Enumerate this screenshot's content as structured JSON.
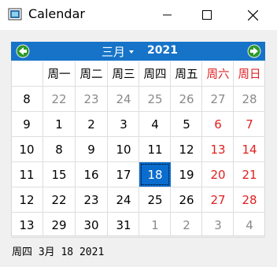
{
  "window": {
    "title": "Calendar"
  },
  "calendar": {
    "month_label": "三月",
    "year_label": "2021",
    "weekday_headers": [
      "周一",
      "周二",
      "周三",
      "周四",
      "周五",
      "周六",
      "周日"
    ],
    "weeks": [
      {
        "week": "8",
        "days": [
          "22",
          "23",
          "24",
          "25",
          "26",
          "27",
          "28"
        ]
      },
      {
        "week": "9",
        "days": [
          "1",
          "2",
          "3",
          "4",
          "5",
          "6",
          "7"
        ]
      },
      {
        "week": "10",
        "days": [
          "8",
          "9",
          "10",
          "11",
          "12",
          "13",
          "14"
        ]
      },
      {
        "week": "11",
        "days": [
          "15",
          "16",
          "17",
          "18",
          "19",
          "20",
          "21"
        ]
      },
      {
        "week": "12",
        "days": [
          "22",
          "23",
          "24",
          "25",
          "26",
          "27",
          "28"
        ]
      },
      {
        "week": "13",
        "days": [
          "29",
          "30",
          "31",
          "1",
          "2",
          "3",
          "4"
        ]
      }
    ],
    "selected_date": "18",
    "colors": {
      "header": "#1673c8",
      "weekend": "#e02020",
      "selected": "#0a6ccd",
      "outside": "#8a8a8a"
    }
  },
  "status": {
    "text": "周四 3月 18 2021"
  }
}
